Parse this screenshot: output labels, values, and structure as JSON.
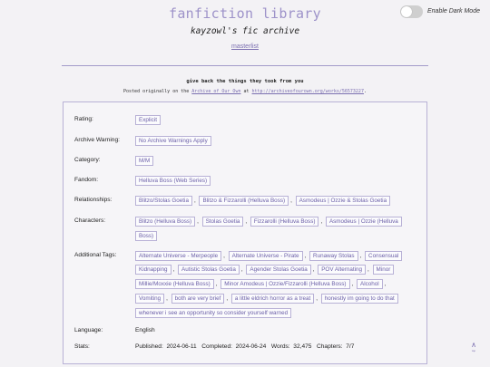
{
  "site": {
    "title": "fanfiction library",
    "subtitle": "kayzowl's fic archive",
    "masterlist_label": "masterlist",
    "dark_mode_label": "Enable Dark Mode",
    "dark_mode_on": false
  },
  "work": {
    "title": "give back the things they took from you",
    "posted_prefix": "Posted originally on the",
    "posted_link": "Archive of Our Own",
    "posted_at": "at",
    "posted_url": "http://archiveofourown.org/works/56573227",
    "posted_suffix": "."
  },
  "meta": {
    "rating_label": "Rating:",
    "rating": "Explicit",
    "warning_label": "Archive Warning:",
    "warning": "No Archive Warnings Apply",
    "category_label": "Category:",
    "category": "M/M",
    "fandom_label": "Fandom:",
    "fandom": "Helluva Boss (Web Series)",
    "relationships_label": "Relationships:",
    "relationships": [
      "Blitzo/Stolas Goetia",
      "Blitzo & Fizzarolli (Helluva Boss)",
      "Asmodeus | Ozzie & Stolas Goetia"
    ],
    "characters_label": "Characters:",
    "characters": [
      "Blitzo (Helluva Boss)",
      "Stolas Goetia",
      "Fizzarolli (Helluva Boss)",
      "Asmodeus | Ozzie (Helluva",
      "Boss)"
    ],
    "tags_label": "Additional Tags:",
    "tags": [
      "Alternate Universe - Merpeople",
      "Alternate Universe - Pirate",
      "Runaway Stolas",
      "Consensual",
      "Kidnapping",
      "Autistic Stolas Goetia",
      "Agender Stolas Goetia",
      "POV Alternating",
      "Minor",
      "Millie/Moxxie (Helluva Boss)",
      "Minor Amodeus | Ozzie/Fizzarolli (Helluva Boss)",
      "Alcohol",
      "Vomiting",
      "both are very brief",
      "a little eldrich horror as a treat",
      "honestly im going to do that",
      "whenever i see an opportunity so consider yourself warned"
    ],
    "language_label": "Language:",
    "language": "English",
    "stats_label": "Stats:",
    "stats": {
      "published_label": "Published:",
      "published": "2024-06-11",
      "completed_label": "Completed:",
      "completed": "2024-06-24",
      "words_label": "Words:",
      "words": "32,475",
      "chapters_label": "Chapters:",
      "chapters": "7/7"
    }
  },
  "back_to_top": {
    "icon": "caret-up-icon",
    "label": "top"
  },
  "colors": {
    "accent": "#9d92c9",
    "link": "#7b6fb0",
    "border": "#b8b1d6",
    "background": "#f3f2f5"
  }
}
